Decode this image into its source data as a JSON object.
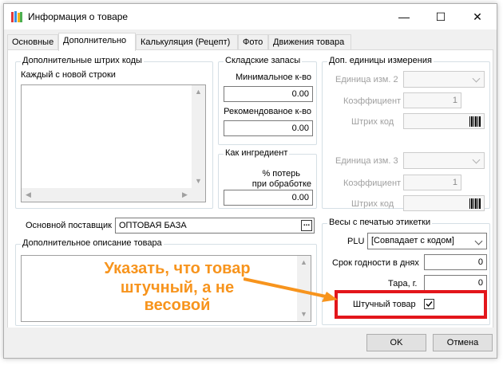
{
  "window": {
    "title": "Информация о товаре",
    "controls": {
      "minimize": "—",
      "maximize": "☐",
      "close": "✕"
    }
  },
  "tabs": [
    {
      "label": "Основные"
    },
    {
      "label": "Дополнительно"
    },
    {
      "label": "Калькуляция (Рецепт)"
    },
    {
      "label": "Фото"
    },
    {
      "label": "Движения товара"
    }
  ],
  "barcodes_group": {
    "title": "Дополнительные штрих коды",
    "hint": "Каждый с новой строки"
  },
  "stock_group": {
    "title": "Складские запасы",
    "min_label": "Минимальное к-во",
    "min_value": "0.00",
    "rec_label": "Рекомендованое к-во",
    "rec_value": "0.00"
  },
  "ingredient_group": {
    "title": "Как ингредиент",
    "loss_label_1": "% потерь",
    "loss_label_2": "при обработке",
    "loss_value": "0.00"
  },
  "units_group": {
    "title": "Доп. единицы измерения",
    "unit2_label": "Единица изм. 2",
    "coef2_label": "Коэффициент",
    "coef2_value": "1",
    "barcode2_label": "Штрих код",
    "unit3_label": "Единица изм. 3",
    "coef3_label": "Коэффициент",
    "coef3_value": "1",
    "barcode3_label": "Штрих код"
  },
  "supplier": {
    "label": "Основной поставщик",
    "value": "ОПТОВАЯ БАЗА"
  },
  "description_group": {
    "title": "Дополнительное описание товара"
  },
  "scales_group": {
    "title": "Весы с печатью этикетки",
    "plu_label": "PLU",
    "plu_value": "[Совпадает с кодом]",
    "shelf_label": "Срок годности в днях",
    "shelf_value": "0",
    "tare_label": "Тара, г.",
    "tare_value": "0",
    "piece_label": "Штучный товар",
    "piece_checked": true
  },
  "annotation": {
    "line1": "Указать, что товар",
    "line2": "штучный, а не весовой",
    "color": "#f7941d",
    "highlight_color": "#e3161b"
  },
  "buttons": {
    "ok": "OK",
    "cancel": "Отмена"
  }
}
